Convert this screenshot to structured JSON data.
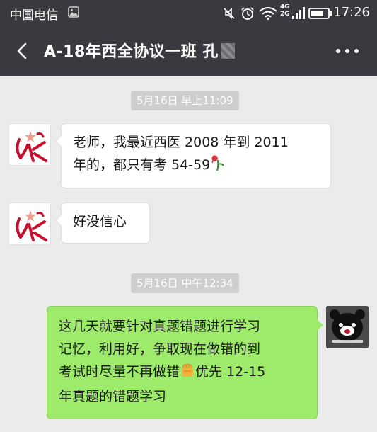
{
  "status_bar": {
    "carrier": "中国电信",
    "network_top": "4G",
    "network_bottom": "2G",
    "time": "17:26",
    "icons": [
      "image-notification-icon",
      "mute-icon",
      "alarm-icon",
      "wifi-icon",
      "signal-icon",
      "battery-icon"
    ]
  },
  "header": {
    "title": "A-18年西全协议一班 孔",
    "back_icon": "chevron-left-icon",
    "more_icon": "more-dots-icon"
  },
  "messages": [
    {
      "type": "time",
      "text": "5月16日 早上11:09"
    },
    {
      "type": "received",
      "text_line1": "老师，我最近西医 2008 年到 2011",
      "text_line2": "年的，都只有考 54-59",
      "emoji": "wilted-rose-icon"
    },
    {
      "type": "received",
      "text": "好没信心"
    },
    {
      "type": "time",
      "text": "5月16日 中午12:34"
    },
    {
      "type": "sent",
      "line1": "这几天就要针对真题错题进行学习",
      "line2": "记忆，利用好，争取现在做错的到",
      "line3_a": "考试时尽量不再做错",
      "line3_b": "优先 12-15",
      "line4": "年真题的错题学习",
      "emoji": "fist-icon"
    }
  ],
  "colors": {
    "bar": "#393a3f",
    "background": "#ebebeb",
    "sent_bubble": "#9eea6a",
    "received_bubble": "#ffffff",
    "time_chip": "#cecece"
  }
}
